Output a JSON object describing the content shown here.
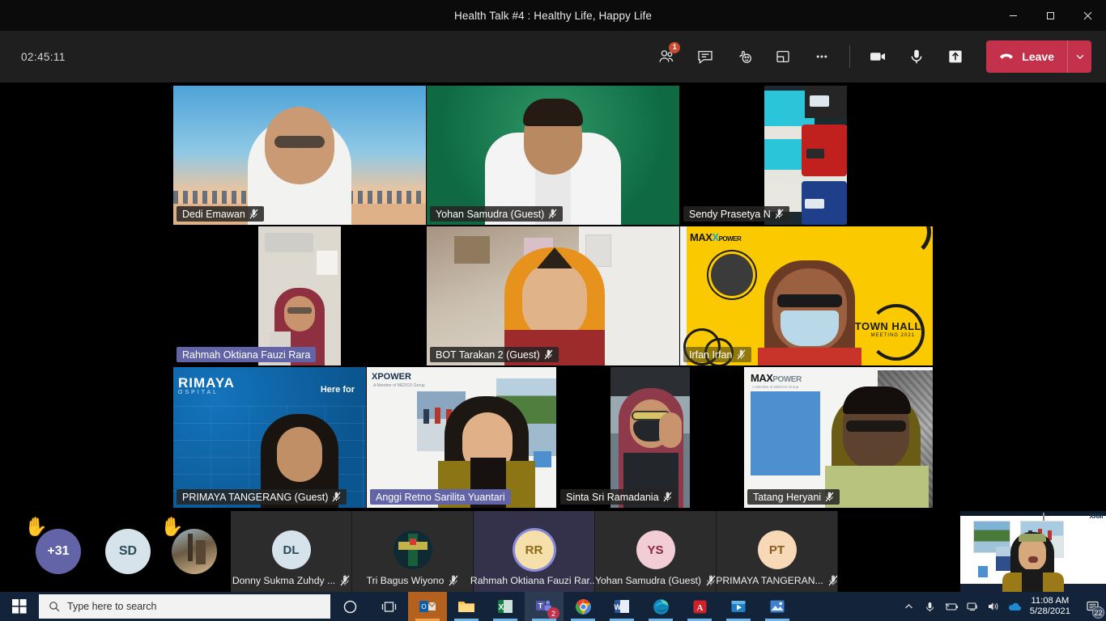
{
  "window": {
    "title": "Health Talk #4 : Healthy Life, Happy Life",
    "minimize_label": "minimize",
    "restore_label": "restore",
    "close_label": "close"
  },
  "toolbar": {
    "timer": "02:45:11",
    "people_label": "People",
    "people_badge": "1",
    "chat_label": "Chat",
    "reactions_label": "Reactions",
    "rooms_label": "Breakout rooms",
    "more_label": "More actions",
    "camera_label": "Camera",
    "mic_label": "Microphone",
    "share_label": "Share content",
    "leave_label": "Leave",
    "leave_color": "#c4314b",
    "badge_color": "#cc4a31"
  },
  "stage": {
    "tiles": [
      {
        "name": "Dedi Emawan",
        "muted": true,
        "speaking": false
      },
      {
        "name": "Yohan Samudra (Guest)",
        "muted": true,
        "speaking": false
      },
      {
        "name": "Sendy Prasetya N",
        "muted": true,
        "speaking": false
      },
      {
        "name": "Rahmah Oktiana Fauzi Rara",
        "muted": false,
        "speaking": true
      },
      {
        "name": "BOT Tarakan 2 (Guest)",
        "muted": true,
        "speaking": false
      },
      {
        "name": "Irfan Irfan",
        "muted": true,
        "speaking": false
      },
      {
        "name": "PRIMAYA TANGERANG (Guest)",
        "muted": true,
        "speaking": false
      },
      {
        "name": "Anggi Retno Sarilita Yuantari",
        "muted": false,
        "speaking": true
      },
      {
        "name": "Sinta Sri Ramadania",
        "muted": true,
        "speaking": false
      },
      {
        "name": "Tatang Heryani",
        "muted": true,
        "speaking": false
      }
    ]
  },
  "roster": {
    "overflow_count": "+31",
    "overflow_color": "#6264a7",
    "hand_icon": "raised-hand-icon",
    "extra_avatars": [
      {
        "initials": "SD",
        "bg": "#d6e3ea",
        "fg": "#2c4a57",
        "hand": false
      },
      {
        "initials": "",
        "bg": "#7a6a55",
        "fg": "#ffffff",
        "hand": true
      }
    ],
    "people": [
      {
        "initials": "DL",
        "name": "Donny Sukma Zuhdy ...",
        "muted": true,
        "speaking": false,
        "bg": "#d6e3ea",
        "fg": "#2c4a57",
        "photo": false
      },
      {
        "initials": "",
        "name": "Tri Bagus Wiyono",
        "muted": true,
        "speaking": false,
        "bg": "#12303a",
        "fg": "#ffffff",
        "photo": true
      },
      {
        "initials": "RR",
        "name": "Rahmah Oktiana Fauzi Rar...",
        "muted": false,
        "speaking": true,
        "bg": "#f5dfab",
        "fg": "#8a6a18",
        "photo": false
      },
      {
        "initials": "YS",
        "name": "Yohan Samudra (Guest)",
        "muted": true,
        "speaking": false,
        "bg": "#f1cdd5",
        "fg": "#8c2440",
        "photo": false
      },
      {
        "initials": "PT",
        "name": "PRIMAYA TANGERAN...",
        "muted": true,
        "speaking": false,
        "bg": "#f7d9b8",
        "fg": "#8a5a1e",
        "photo": false
      }
    ]
  },
  "selfview": {
    "label": "self-video-preview"
  },
  "taskbar": {
    "start_label": "Start",
    "search_placeholder": "Type here to search",
    "search_icon": "search-icon",
    "cortana_label": "Cortana",
    "taskview_label": "Task View",
    "apps": [
      {
        "name": "Outlook",
        "running": true,
        "active": true
      },
      {
        "name": "File Explorer",
        "running": true,
        "active": false
      },
      {
        "name": "Excel",
        "running": true,
        "active": false
      },
      {
        "name": "Microsoft Teams",
        "running": true,
        "active": true,
        "badge": "2"
      },
      {
        "name": "Google Chrome",
        "running": true,
        "active": false
      },
      {
        "name": "Word",
        "running": true,
        "active": false
      },
      {
        "name": "Microsoft Edge",
        "running": true,
        "active": false
      },
      {
        "name": "Adobe Acrobat Reader",
        "running": true,
        "active": false
      },
      {
        "name": "Movies and TV",
        "running": true,
        "active": false
      },
      {
        "name": "Photos",
        "running": true,
        "active": false
      }
    ],
    "tray": {
      "show_hidden_label": "Show hidden icons",
      "mic_label": "Microphone in use",
      "battery_label": "Battery",
      "network_label": "Network",
      "volume_label": "Volume",
      "onedrive_label": "OneDrive",
      "time": "11:08 AM",
      "date": "5/28/2021",
      "notifications_count": "22"
    }
  }
}
